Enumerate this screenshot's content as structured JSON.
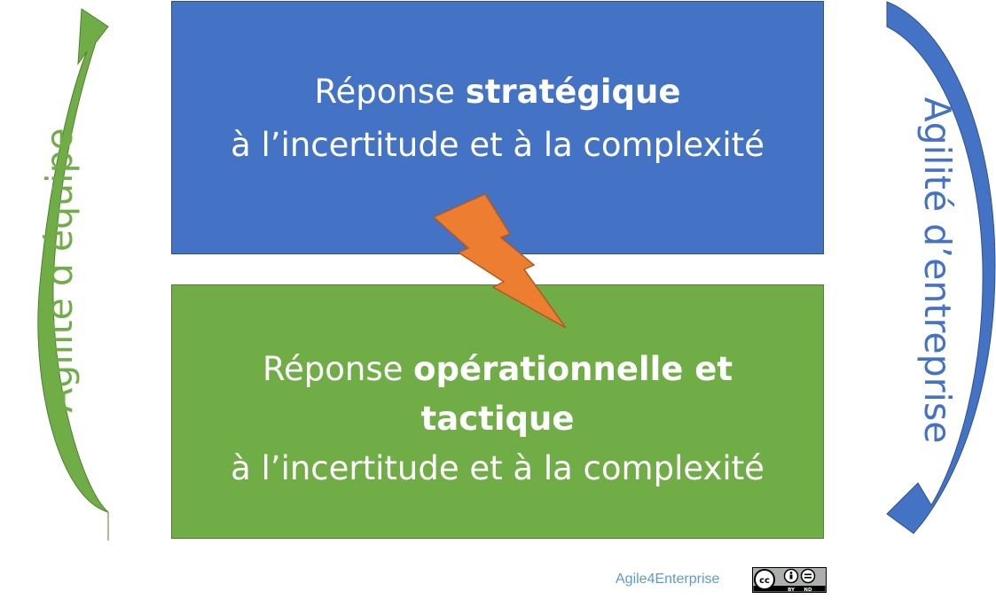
{
  "top_box": {
    "line1_normal": "Réponse ",
    "line1_bold": "stratégique",
    "line2": "à l’incertitude et à la complexité",
    "color": "#4472c4"
  },
  "bottom_box": {
    "line1_normal": "Réponse ",
    "line1_bold": "opérationnelle et",
    "line2_bold": "tactique",
    "line3": "à l’incertitude et à la complexité",
    "color": "#70ad47"
  },
  "left_label": "Agilité d’équipe",
  "right_label": "Agilité d’entreprise",
  "footer": {
    "brand": "Agile4Enterprise",
    "license_badge": {
      "cc": "cc",
      "by": "BY",
      "nd": "ND"
    }
  },
  "icons": {
    "lightning": "lightning-bolt-icon",
    "up_arrow": "curved-arrow-up-icon",
    "down_arrow": "curved-arrow-down-icon"
  }
}
